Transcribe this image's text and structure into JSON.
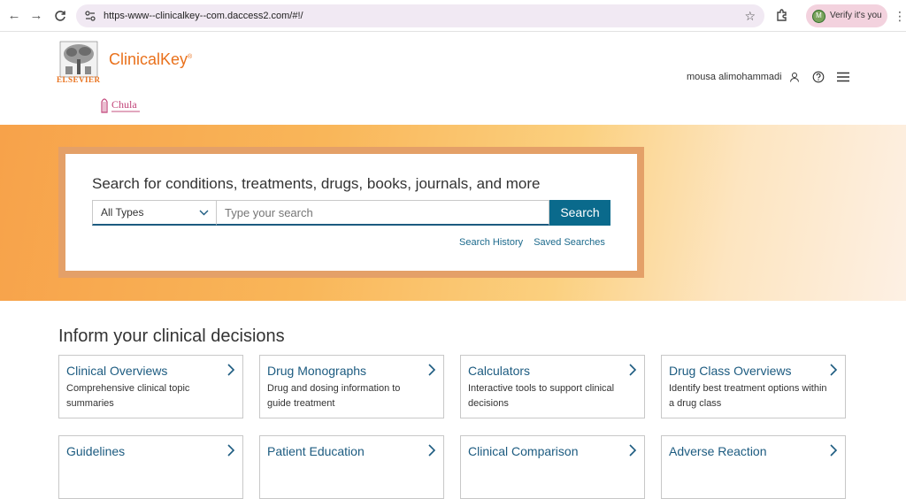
{
  "browser": {
    "url": "https-www--clinicalkey--com.daccess2.com/#!/",
    "verify_label": "Verify it's you",
    "avatar_letter": "M"
  },
  "header": {
    "publisher": "ELSEVIER",
    "brand": "ClinicalKey",
    "brand_mark": "®",
    "institution": "Chula",
    "user_name": "mousa alimohammadi"
  },
  "search": {
    "heading": "Search for conditions, treatments, drugs, books, journals, and more",
    "type_selected": "All Types",
    "placeholder": "Type your search",
    "button_label": "Search",
    "history_link": "Search History",
    "saved_link": "Saved Searches"
  },
  "main": {
    "section_title": "Inform your clinical decisions",
    "cards": [
      {
        "title": "Clinical Overviews",
        "desc": "Comprehensive clinical topic summaries"
      },
      {
        "title": "Drug Monographs",
        "desc": "Drug and dosing information to guide treatment"
      },
      {
        "title": "Calculators",
        "desc": "Interactive tools to support clinical decisions"
      },
      {
        "title": "Drug Class Overviews",
        "desc": "Identify best treatment options within a drug class"
      },
      {
        "title": "Guidelines",
        "desc": ""
      },
      {
        "title": "Patient Education",
        "desc": ""
      },
      {
        "title": "Clinical Comparison",
        "desc": ""
      },
      {
        "title": "Adverse Reaction",
        "desc": ""
      }
    ]
  },
  "colors": {
    "brand_orange": "#e9711c",
    "link_blue": "#1c5b80",
    "search_button": "#0a6a8c"
  }
}
